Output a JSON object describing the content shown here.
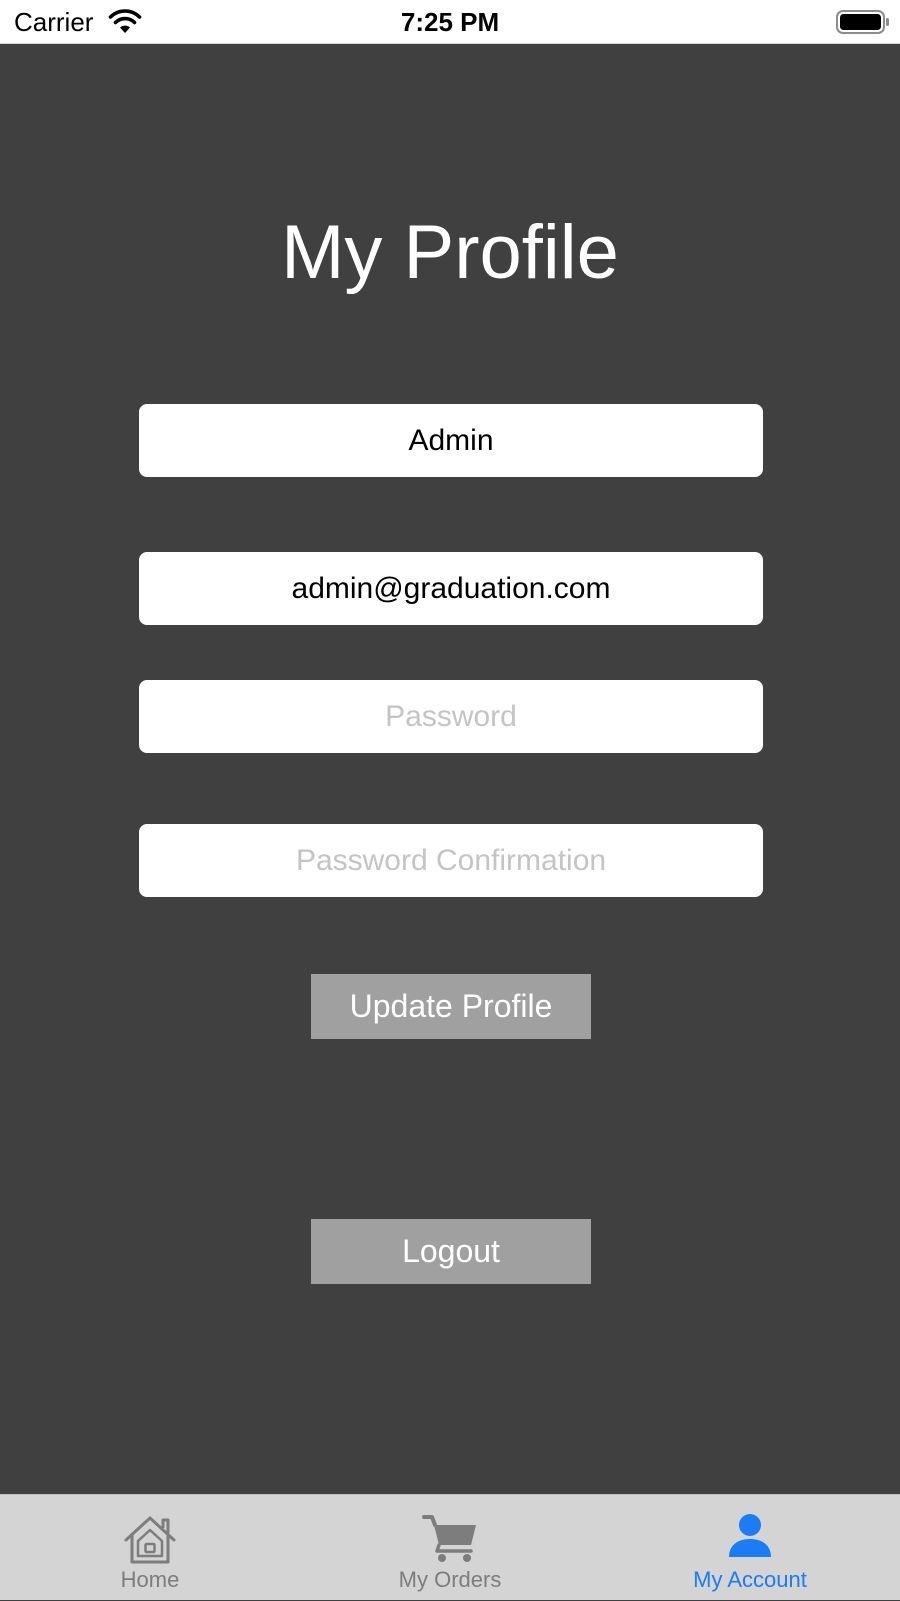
{
  "status_bar": {
    "carrier": "Carrier",
    "time": "7:25 PM"
  },
  "page": {
    "title": "My Profile"
  },
  "form": {
    "name_value": "Admin",
    "email_value": "admin@graduation.com",
    "password_placeholder": "Password",
    "password_confirmation_placeholder": "Password Confirmation"
  },
  "buttons": {
    "update_label": "Update Profile",
    "logout_label": "Logout"
  },
  "tabs": [
    {
      "label": "Home",
      "icon": "home-icon",
      "active": false
    },
    {
      "label": "My Orders",
      "icon": "cart-icon",
      "active": false
    },
    {
      "label": "My Account",
      "icon": "person-icon",
      "active": true
    }
  ],
  "colors": {
    "background": "#404040",
    "button": "#a0a0a0",
    "tab_bar": "#d4d4d4",
    "tab_active": "#1c7cf4",
    "tab_inactive": "#7d7d7d"
  }
}
